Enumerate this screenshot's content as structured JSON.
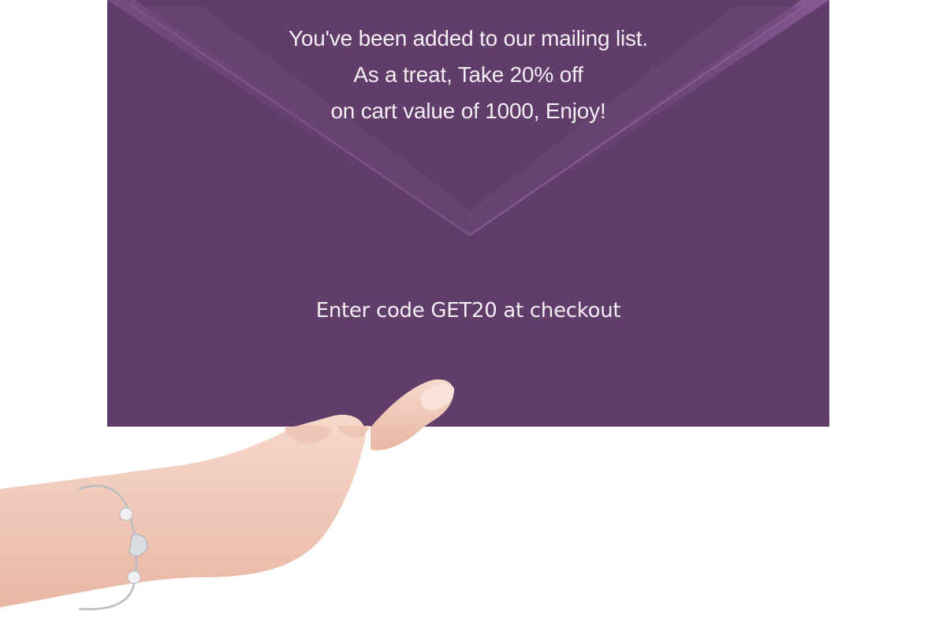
{
  "popup": {
    "message_lines": [
      "You've been added to our mailing list.",
      "As a treat, Take 20% off",
      "on cart value of 1000, Enjoy!"
    ],
    "code_text": "Enter code GET20 at checkout"
  },
  "colors": {
    "envelope": "#613d6a",
    "flap_highlight": "#8a5a98",
    "text": "#f3eef4",
    "skin": "#f3cfc0"
  },
  "icons": {
    "flap": "envelope-flap-graphic",
    "hand": "hand-with-bracelet-graphic"
  }
}
